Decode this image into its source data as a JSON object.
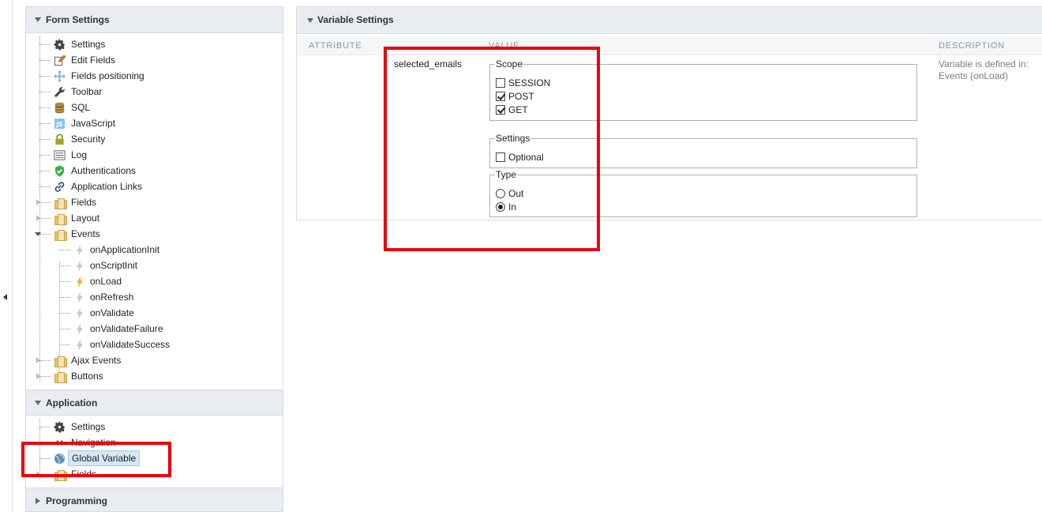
{
  "form_settings": {
    "title": "Form Settings",
    "items": [
      {
        "label": "Settings",
        "icon": "gear-icon"
      },
      {
        "label": "Edit Fields",
        "icon": "edit-icon"
      },
      {
        "label": "Fields positioning",
        "icon": "move-icon"
      },
      {
        "label": "Toolbar",
        "icon": "wrench-icon"
      },
      {
        "label": "SQL",
        "icon": "database-icon"
      },
      {
        "label": "JavaScript",
        "icon": "javascript-icon"
      },
      {
        "label": "Security",
        "icon": "lock-icon"
      },
      {
        "label": "Log",
        "icon": "log-icon"
      },
      {
        "label": "Authentications",
        "icon": "shield-check-icon"
      },
      {
        "label": "Application Links",
        "icon": "link-icon"
      },
      {
        "label": "Fields",
        "icon": "folder-icon"
      },
      {
        "label": "Layout",
        "icon": "folder-icon"
      },
      {
        "label": "Events",
        "icon": "folder-icon"
      }
    ],
    "events": [
      {
        "label": "onApplicationInit",
        "active": false
      },
      {
        "label": "onScriptInit",
        "active": false
      },
      {
        "label": "onLoad",
        "active": true
      },
      {
        "label": "onRefresh",
        "active": false
      },
      {
        "label": "onValidate",
        "active": false
      },
      {
        "label": "onValidateFailure",
        "active": false
      },
      {
        "label": "onValidateSuccess",
        "active": false
      }
    ],
    "tail_items": [
      {
        "label": "Ajax Events",
        "icon": "folder-icon"
      },
      {
        "label": "Buttons",
        "icon": "folder-icon"
      }
    ]
  },
  "application": {
    "title": "Application",
    "items": [
      {
        "label": "Settings",
        "icon": "gear-icon"
      },
      {
        "label": "Navigation",
        "icon": "navigation-icon"
      },
      {
        "label": "Global Variable",
        "icon": "globe-icon",
        "selected": true
      },
      {
        "label": "Fields",
        "icon": "folder-icon"
      }
    ]
  },
  "programming": {
    "title": "Programming"
  },
  "variable_settings": {
    "title": "Variable Settings",
    "columns": {
      "attribute": "ATTRIBUTE",
      "value": "VALUE",
      "description": "DESCRIPTION"
    },
    "variable_name": "selected_emails",
    "scope": {
      "legend": "Scope",
      "options": [
        {
          "label": "SESSION",
          "checked": false
        },
        {
          "label": "POST",
          "checked": true
        },
        {
          "label": "GET",
          "checked": true
        }
      ]
    },
    "settings": {
      "legend": "Settings",
      "options": [
        {
          "label": "Optional",
          "checked": false
        }
      ]
    },
    "type": {
      "legend": "Type",
      "options": [
        {
          "label": "Out",
          "selected": false
        },
        {
          "label": "In",
          "selected": true
        }
      ]
    },
    "description_line1": "Variable is defined in:",
    "description_line2": "Events (onLoad)"
  },
  "colors": {
    "highlight_red": "#e8000f",
    "header_bg": "#e9edf1",
    "selected_bg": "#d3e8f7"
  }
}
